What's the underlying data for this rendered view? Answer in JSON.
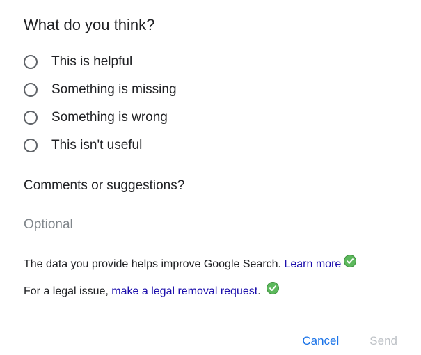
{
  "dialog": {
    "title": "What do you think?",
    "options": [
      {
        "label": "This is helpful"
      },
      {
        "label": "Something is missing"
      },
      {
        "label": "Something is wrong"
      },
      {
        "label": "This isn't useful"
      }
    ],
    "comments_label": "Comments or suggestions?",
    "comment_placeholder": "Optional",
    "comment_value": "",
    "info_text": "The data you provide helps improve Google Search.",
    "learn_more_link": "Learn more",
    "legal_prefix": "For a legal issue,",
    "legal_link": "make a legal removal request",
    "legal_suffix": ".",
    "cancel_label": "Cancel",
    "send_label": "Send",
    "send_disabled": true,
    "icons": {
      "verified": "check-circle-icon"
    },
    "colors": {
      "link": "#1a0dab",
      "primary_button": "#1a73e8",
      "disabled_button": "#bdc1c6",
      "check": "#5cb85c"
    }
  }
}
